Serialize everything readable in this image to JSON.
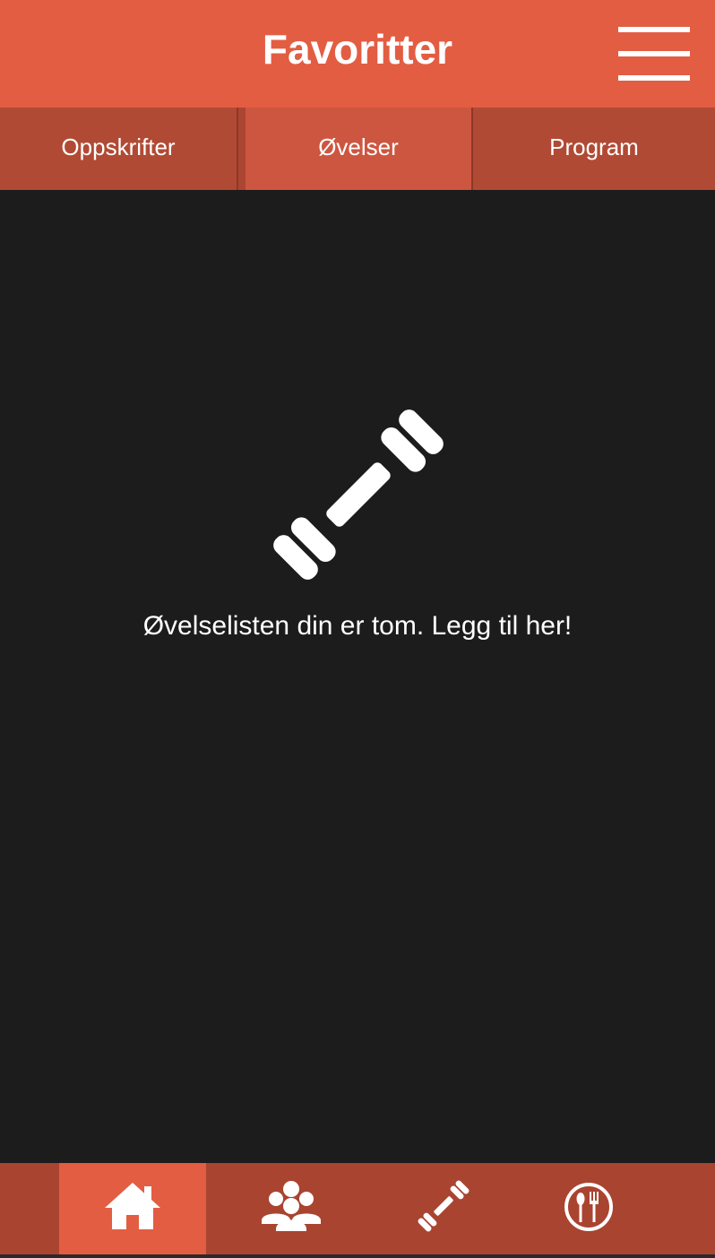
{
  "header": {
    "title": "Favoritter",
    "menu_icon": "hamburger-menu-icon"
  },
  "tabs": [
    {
      "label": "Oppskrifter",
      "active": false
    },
    {
      "label": "Øvelser",
      "active": true
    },
    {
      "label": "Program",
      "active": false
    }
  ],
  "content": {
    "empty_icon": "dumbbell-icon",
    "empty_message": "Øvelselisten din er tom. Legg til her!"
  },
  "bottom_nav": {
    "items": [
      {
        "icon": "home-icon",
        "active": true
      },
      {
        "icon": "group-icon",
        "active": false
      },
      {
        "icon": "dumbbell-icon",
        "active": false
      },
      {
        "icon": "plate-cutlery-icon",
        "active": false
      }
    ]
  },
  "colors": {
    "accent": "#e35d43",
    "tab_bar": "#b14a34",
    "tab_active": "#cd5640",
    "nav_bar": "#a94431",
    "background": "#1c1c1c",
    "text": "#ffffff"
  }
}
